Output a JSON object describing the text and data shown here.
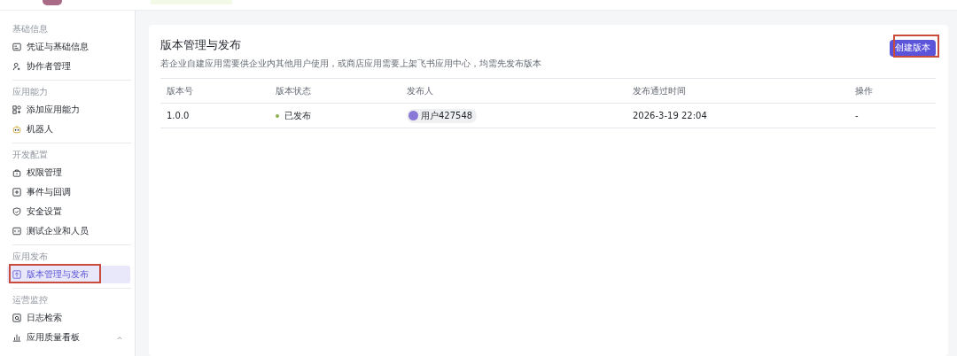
{
  "sidebar": {
    "groups": [
      {
        "label": "基础信息",
        "items": [
          {
            "label": "凭证与基础信息",
            "selected": false,
            "highlighted": false
          },
          {
            "label": "协作者管理",
            "selected": false,
            "highlighted": false
          }
        ]
      },
      {
        "label": "应用能力",
        "items": [
          {
            "label": "添加应用能力",
            "selected": false,
            "highlighted": false
          },
          {
            "label": "机器人",
            "selected": false,
            "highlighted": false
          }
        ]
      },
      {
        "label": "开发配置",
        "items": [
          {
            "label": "权限管理",
            "selected": false,
            "highlighted": false
          },
          {
            "label": "事件与回调",
            "selected": false,
            "highlighted": false
          },
          {
            "label": "安全设置",
            "selected": false,
            "highlighted": false
          },
          {
            "label": "测试企业和人员",
            "selected": false,
            "highlighted": false
          }
        ]
      },
      {
        "label": "应用发布",
        "items": [
          {
            "label": "版本管理与发布",
            "selected": true,
            "highlighted": true
          }
        ]
      },
      {
        "label": "运营监控",
        "items": [
          {
            "label": "日志检索",
            "selected": false,
            "highlighted": false
          },
          {
            "label": "应用质量看板",
            "selected": false,
            "highlighted": false,
            "expanded": true
          }
        ]
      }
    ]
  },
  "page": {
    "title": "版本管理与发布",
    "description": "若企业自建应用需要供企业内其他用户使用，或商店应用需要上架飞书应用中心，均需先发布版本",
    "create_button": {
      "label": "创建版本",
      "highlighted": true
    }
  },
  "table": {
    "columns": [
      "版本号",
      "版本状态",
      "发布人",
      "发布通过时间",
      "操作"
    ],
    "rows": [
      {
        "version": "1.0.0",
        "status": "已发布",
        "color": "#8bb24a",
        "publisher": "用户427548",
        "time": "2026-3-19 22:04",
        "action": "-"
      }
    ]
  }
}
